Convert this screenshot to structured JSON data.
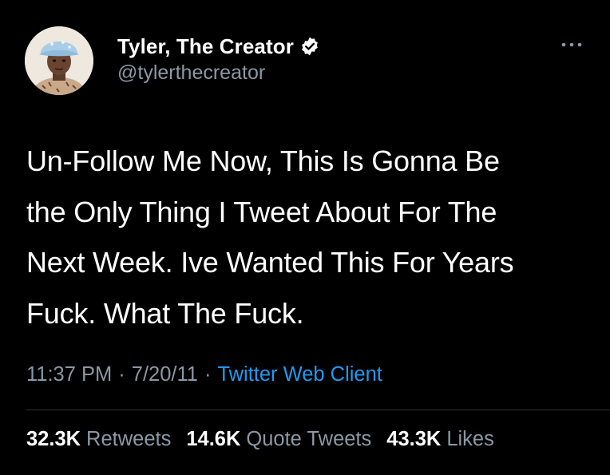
{
  "author": {
    "display_name": "Tyler, The Creator",
    "handle": "@tylerthecreator",
    "verified_icon": "verified-badge-icon",
    "avatar_icon": "avatar-photo"
  },
  "menu_icon": "more-options-icon",
  "tweet": {
    "text": "Un-Follow Me Now, This Is Gonna Be\nthe Only Thing I Tweet About For The\nNext Week. Ive Wanted This For Years\nFuck. What The Fuck."
  },
  "meta": {
    "time": "11:37 PM",
    "separator": "·",
    "date": "7/20/11",
    "client": "Twitter Web Client"
  },
  "stats": {
    "retweets_count": "32.3K",
    "retweets_label": "Retweets",
    "quotes_count": "14.6K",
    "quotes_label": "Quote Tweets",
    "likes_count": "43.3K",
    "likes_label": "Likes"
  },
  "colors": {
    "background": "#000000",
    "text": "#ffffff",
    "muted": "#8b98a5",
    "link": "#1d9bf0",
    "divider": "#2f3336",
    "verified": "#ffffff"
  }
}
